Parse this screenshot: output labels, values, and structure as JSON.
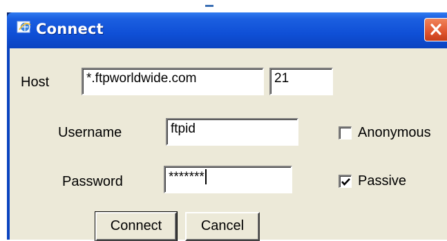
{
  "window": {
    "title": "Connect",
    "title_icon": "ie-globe-icon",
    "close_icon": "close-icon"
  },
  "form": {
    "host_label": "Host",
    "host_value": "*.ftpworldwide.com",
    "port_value": "21",
    "username_label": "Username",
    "username_value": "ftpid",
    "password_label": "Password",
    "password_value": "*******",
    "anonymous_label": "Anonymous",
    "anonymous_checked": false,
    "passive_label": "Passive",
    "passive_checked": true
  },
  "buttons": {
    "connect_label": "Connect",
    "cancel_label": "Cancel"
  },
  "colors": {
    "titlebar": "#0f4fd6",
    "client_bg": "#ece9d8",
    "close_button": "#e0552f"
  }
}
